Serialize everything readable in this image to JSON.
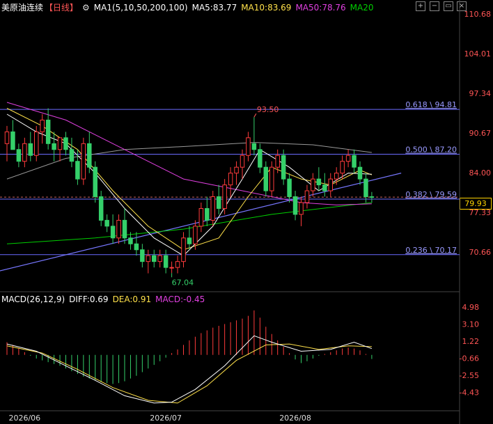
{
  "header": {
    "instrument": "美原油连续",
    "period": "【日线】",
    "settings_icon": "gear-icon",
    "ma_label": "MA1(5,10,50,200,100)",
    "ma5": "MA5:83.77",
    "ma10": "MA10:83.69",
    "ma50": "MA50:78.76",
    "ma20": "MA20",
    "controls": [
      "expand-icon",
      "collapse-icon",
      "dash-icon",
      "close-icon"
    ]
  },
  "macd_header": {
    "label": "MACD(26,12,9)",
    "diff": "DIFF:0.69",
    "dea": "DEA:0.91",
    "macd": "MACD:-0.45"
  },
  "colors": {
    "up": "#ff3b3b",
    "down": "#35d06a",
    "ma5": "#ffffff",
    "ma10": "#ffe14a",
    "ma50": "#e040e0",
    "ma20": "#00d000",
    "ma200": "#9a9a9a",
    "fib": "#6b6bff",
    "price": "#ffd400",
    "axis_text": "#ff5555"
  },
  "current_price": "79.93",
  "chart_data": [
    {
      "type": "candlestick",
      "price_ticks": [
        "110.68",
        "104.01",
        "97.34",
        "90.67",
        "84.00",
        "77.33",
        "70.66"
      ],
      "ylim": [
        64.0,
        111.0
      ],
      "x_labels": [
        "2026/06",
        "2026/07",
        "2026/08"
      ],
      "fib_levels": [
        {
          "label": "0.618 \\ 94.81",
          "value": 94.81
        },
        {
          "label": "0.500 \\ 87.20",
          "value": 87.2
        },
        {
          "label": "0.382 \\ 79.59",
          "value": 79.59
        },
        {
          "label": "0.236 \\ 70.17",
          "value": 70.17
        }
      ],
      "annotations": [
        {
          "text": "93.50",
          "value": 93.5,
          "bar": 42
        },
        {
          "text": "67.04",
          "value": 67.04,
          "bar": 28
        }
      ],
      "ohlc": [
        [
          89,
          92,
          86,
          91
        ],
        [
          91,
          93,
          88,
          88
        ],
        [
          88,
          89,
          85,
          86
        ],
        [
          86,
          90,
          85,
          89
        ],
        [
          89,
          91,
          86,
          87
        ],
        [
          87,
          92,
          86,
          91
        ],
        [
          91,
          94,
          89,
          93
        ],
        [
          93,
          95,
          88,
          89
        ],
        [
          89,
          91,
          86,
          88
        ],
        [
          88,
          90,
          86,
          90
        ],
        [
          90,
          91,
          87,
          88
        ],
        [
          88,
          90,
          85,
          86
        ],
        [
          86,
          88,
          82,
          83
        ],
        [
          83,
          90,
          82,
          89
        ],
        [
          89,
          91,
          84,
          85
        ],
        [
          85,
          86,
          79,
          80
        ],
        [
          80,
          81,
          75,
          76
        ],
        [
          76,
          77,
          74,
          75
        ],
        [
          75,
          77,
          72,
          73
        ],
        [
          73,
          77,
          72,
          76
        ],
        [
          76,
          78,
          72,
          73
        ],
        [
          73,
          74,
          71,
          72
        ],
        [
          72,
          74,
          70,
          71
        ],
        [
          71,
          72,
          68,
          69
        ],
        [
          69,
          71,
          67,
          70
        ],
        [
          70,
          71,
          68,
          69
        ],
        [
          69,
          71,
          68,
          70
        ],
        [
          70,
          71,
          67,
          68
        ],
        [
          68,
          69,
          67.04,
          68
        ],
        [
          68,
          70,
          67,
          69
        ],
        [
          69,
          74,
          68,
          73
        ],
        [
          73,
          75,
          71,
          72
        ],
        [
          72,
          76,
          71,
          75
        ],
        [
          75,
          79,
          74,
          78
        ],
        [
          78,
          80,
          75,
          76
        ],
        [
          76,
          81,
          75,
          80
        ],
        [
          80,
          82,
          77,
          78
        ],
        [
          78,
          83,
          77,
          82
        ],
        [
          82,
          85,
          80,
          84
        ],
        [
          84,
          86,
          82,
          85
        ],
        [
          85,
          88,
          83,
          87
        ],
        [
          87,
          91,
          86,
          90
        ],
        [
          89,
          93.5,
          87,
          88
        ],
        [
          88,
          89,
          84,
          85
        ],
        [
          85,
          86,
          80,
          81
        ],
        [
          81,
          86,
          80,
          85
        ],
        [
          85,
          88,
          84,
          87
        ],
        [
          87,
          88,
          82,
          83
        ],
        [
          83,
          84,
          79,
          80
        ],
        [
          80,
          81,
          76,
          77
        ],
        [
          77,
          80,
          75,
          79
        ],
        [
          79,
          82,
          78,
          81
        ],
        [
          81,
          84,
          80,
          83
        ],
        [
          83,
          85,
          81,
          82
        ],
        [
          82,
          84,
          80,
          81
        ],
        [
          81,
          84,
          80,
          83
        ],
        [
          83,
          85,
          82,
          84
        ],
        [
          84,
          87,
          83,
          86
        ],
        [
          86,
          88,
          85,
          87
        ],
        [
          87,
          88,
          84,
          85
        ],
        [
          85,
          86,
          82,
          83
        ],
        [
          83,
          84,
          79,
          80
        ],
        [
          80,
          80.8,
          79,
          79.93
        ]
      ],
      "ma5": [
        [
          0,
          94
        ],
        [
          5,
          91
        ],
        [
          10,
          89
        ],
        [
          15,
          84
        ],
        [
          20,
          78
        ],
        [
          25,
          73
        ],
        [
          30,
          70
        ],
        [
          35,
          75
        ],
        [
          40,
          83
        ],
        [
          43,
          88
        ],
        [
          48,
          85
        ],
        [
          53,
          81
        ],
        [
          58,
          84
        ],
        [
          62,
          83.8
        ]
      ],
      "ma10": [
        [
          0,
          95
        ],
        [
          6,
          92
        ],
        [
          12,
          88
        ],
        [
          18,
          81
        ],
        [
          24,
          75
        ],
        [
          30,
          71
        ],
        [
          36,
          73
        ],
        [
          41,
          80
        ],
        [
          45,
          85
        ],
        [
          50,
          83
        ],
        [
          55,
          82
        ],
        [
          60,
          84.5
        ],
        [
          62,
          83.7
        ]
      ],
      "ma50": [
        [
          0,
          96
        ],
        [
          10,
          93
        ],
        [
          20,
          88
        ],
        [
          30,
          83
        ],
        [
          40,
          81
        ],
        [
          50,
          79
        ],
        [
          56,
          78.6
        ],
        [
          62,
          78.8
        ]
      ],
      "ma20": [
        [
          0,
          72
        ],
        [
          15,
          73
        ],
        [
          30,
          74.5
        ],
        [
          45,
          77
        ],
        [
          62,
          79
        ]
      ],
      "ma200": [
        [
          0,
          83
        ],
        [
          10,
          86.5
        ],
        [
          20,
          88
        ],
        [
          30,
          88.5
        ],
        [
          42,
          89.2
        ],
        [
          52,
          88.8
        ],
        [
          62,
          87.5
        ]
      ],
      "trendline": [
        [
          -5,
          66.5
        ],
        [
          67,
          84.0
        ]
      ],
      "macd": {
        "ticks": [
          "4.98",
          "3.10",
          "1.22",
          "-0.66",
          "-2.55",
          "-4.43"
        ],
        "ylim": [
          -6.0,
          5.5
        ],
        "hist": [
          1.4,
          1.1,
          0.7,
          0.3,
          -0.1,
          -0.4,
          -0.6,
          -0.8,
          -1.0,
          -1.2,
          -1.5,
          -1.8,
          -2.1,
          -2.4,
          -2.6,
          -2.8,
          -3.0,
          -3.1,
          -3.2,
          -3.1,
          -2.9,
          -2.6,
          -2.3,
          -1.9,
          -1.5,
          -1.1,
          -0.7,
          -0.3,
          0.2,
          0.6,
          1.1,
          1.6,
          2.0,
          2.4,
          2.7,
          3.0,
          3.2,
          3.4,
          3.6,
          3.8,
          4.0,
          4.3,
          4.9,
          4.1,
          3.1,
          2.3,
          1.6,
          0.9,
          0.2,
          -0.5,
          -0.9,
          -0.7,
          -0.4,
          -0.1,
          0.1,
          0.3,
          0.5,
          0.7,
          0.8,
          0.7,
          0.5,
          0.1,
          -0.45
        ],
        "diff": [
          [
            0,
            1.2
          ],
          [
            5,
            0.4
          ],
          [
            10,
            -1.2
          ],
          [
            15,
            -2.8
          ],
          [
            20,
            -4.5
          ],
          [
            25,
            -5.3
          ],
          [
            28,
            -5.2
          ],
          [
            32,
            -3.8
          ],
          [
            37,
            -1.2
          ],
          [
            42,
            2.1
          ],
          [
            45,
            1.4
          ],
          [
            50,
            0.4
          ],
          [
            55,
            0.6
          ],
          [
            59,
            1.4
          ],
          [
            62,
            0.69
          ]
        ],
        "dea": [
          [
            0,
            1.0
          ],
          [
            6,
            0.2
          ],
          [
            12,
            -1.6
          ],
          [
            18,
            -3.6
          ],
          [
            24,
            -5.0
          ],
          [
            29,
            -5.3
          ],
          [
            34,
            -3.4
          ],
          [
            39,
            -0.6
          ],
          [
            44,
            1.1
          ],
          [
            48,
            1.2
          ],
          [
            53,
            0.6
          ],
          [
            58,
            1.0
          ],
          [
            62,
            0.91
          ]
        ]
      }
    }
  ]
}
